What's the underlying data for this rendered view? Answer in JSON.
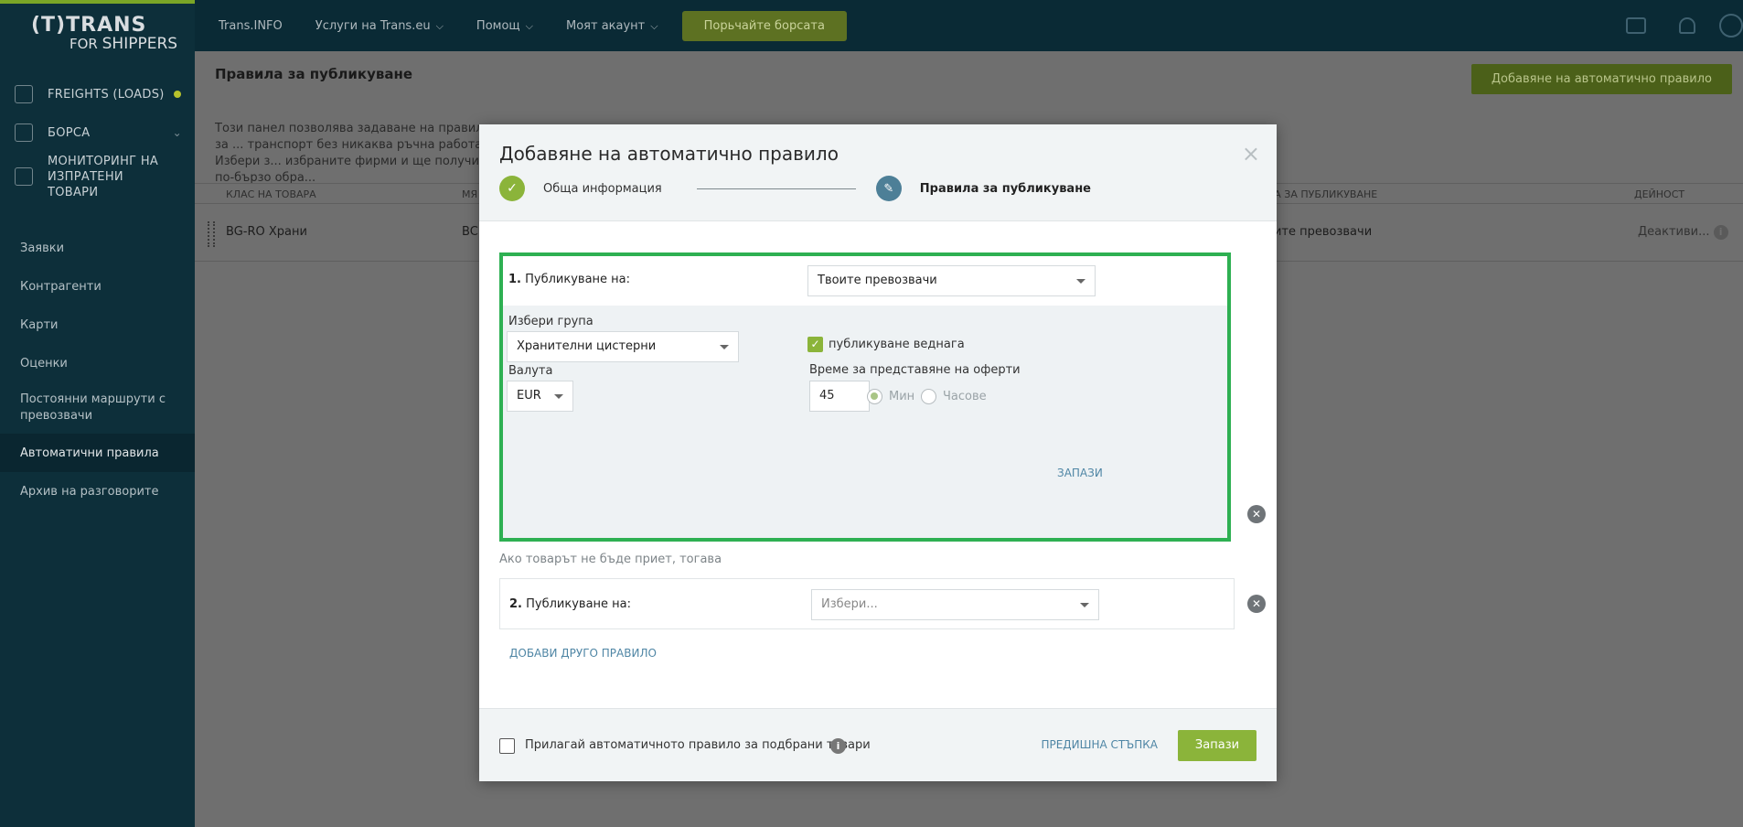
{
  "brand": {
    "logo_line1": "(T)TRANS",
    "logo_line2_pre": "FOR",
    "logo_line2_main": "SHIPPERS"
  },
  "sidebar": {
    "main": [
      {
        "label": "FREIGHTS (LOADS)",
        "icon": "freight-icon"
      },
      {
        "label": "БОРСА",
        "icon": "cube-icon"
      },
      {
        "label": "МОНИТОРИНГ НА ИЗПРАТЕНИ ТОВАРИ",
        "icon": "monitoring-icon"
      }
    ],
    "sub": [
      {
        "label": "Заявки"
      },
      {
        "label": "Контрагенти"
      },
      {
        "label": "Карти"
      },
      {
        "label": "Оценки"
      },
      {
        "label": "Постоянни маршрути с превозвачи"
      },
      {
        "label": "Автоматични правила"
      },
      {
        "label": "Архив на разговорите"
      }
    ]
  },
  "topbar": {
    "menu": [
      "Trans.INFO",
      "Услуги на Trans.eu",
      "Помощ",
      "Моят акаунт"
    ],
    "borsa_button": "Порьчайте борсата"
  },
  "page": {
    "title": "Правила за публикуване",
    "add_button": "Добавяне на автоматично правило",
    "description": "Този панел позволява задаване на правила за ... транспорт без никаква ръчна работа. Избери з... избраните фирми и ще получиш по-бързо обра...",
    "columns": {
      "class": "КЛАС НА ТОВАРА",
      "place": "МЯ",
      "rules": "ЛА ЗА ПУБЛИКУВАНЕ",
      "action": "ДЕЙНОСТ"
    },
    "row": {
      "name": "BG-RO Храни",
      "place": "BC",
      "rule": "оите превозвачи",
      "action": "Деактиви..."
    }
  },
  "modal": {
    "title": "Добавяне на автоматично правило",
    "close": "×",
    "steps": [
      {
        "label": "Обща информация",
        "state": "done"
      },
      {
        "label": "Правила за публикуване",
        "state": "current"
      }
    ],
    "rule1": {
      "number": "1.",
      "label": "Публикуване на:",
      "target": "Твоите превозвачи",
      "group_label": "Избери група",
      "group_value": "Хранителни цистерни",
      "currency_label": "Валута",
      "currency_value": "EUR",
      "publish_now_label": "публикуване веднага",
      "publish_now": true,
      "offer_time_label": "Време за представяне на оферти",
      "offer_time_value": "45",
      "unit_min": "Мин",
      "unit_hours": "Часове",
      "save_link": "ЗАПАЗИ"
    },
    "fallback_text": "Ако товарът не бъде приет, тогава",
    "rule2": {
      "number": "2.",
      "label": "Публикуване на:",
      "placeholder": "Избери..."
    },
    "add_rule_link": "ДОБАВИ ДРУГО ПРАВИЛО",
    "footer": {
      "apply_label": "Прилагай автоматичното правило за подбрани товари",
      "prev_link": "ПРЕДИШНА СТЪПКА",
      "save_button": "Запази"
    }
  },
  "colors": {
    "sidebar_bg": "#0d2f3a",
    "accent_green": "#8bb43a",
    "highlight_border": "#2eb052",
    "link_blue": "#4f86a5"
  }
}
